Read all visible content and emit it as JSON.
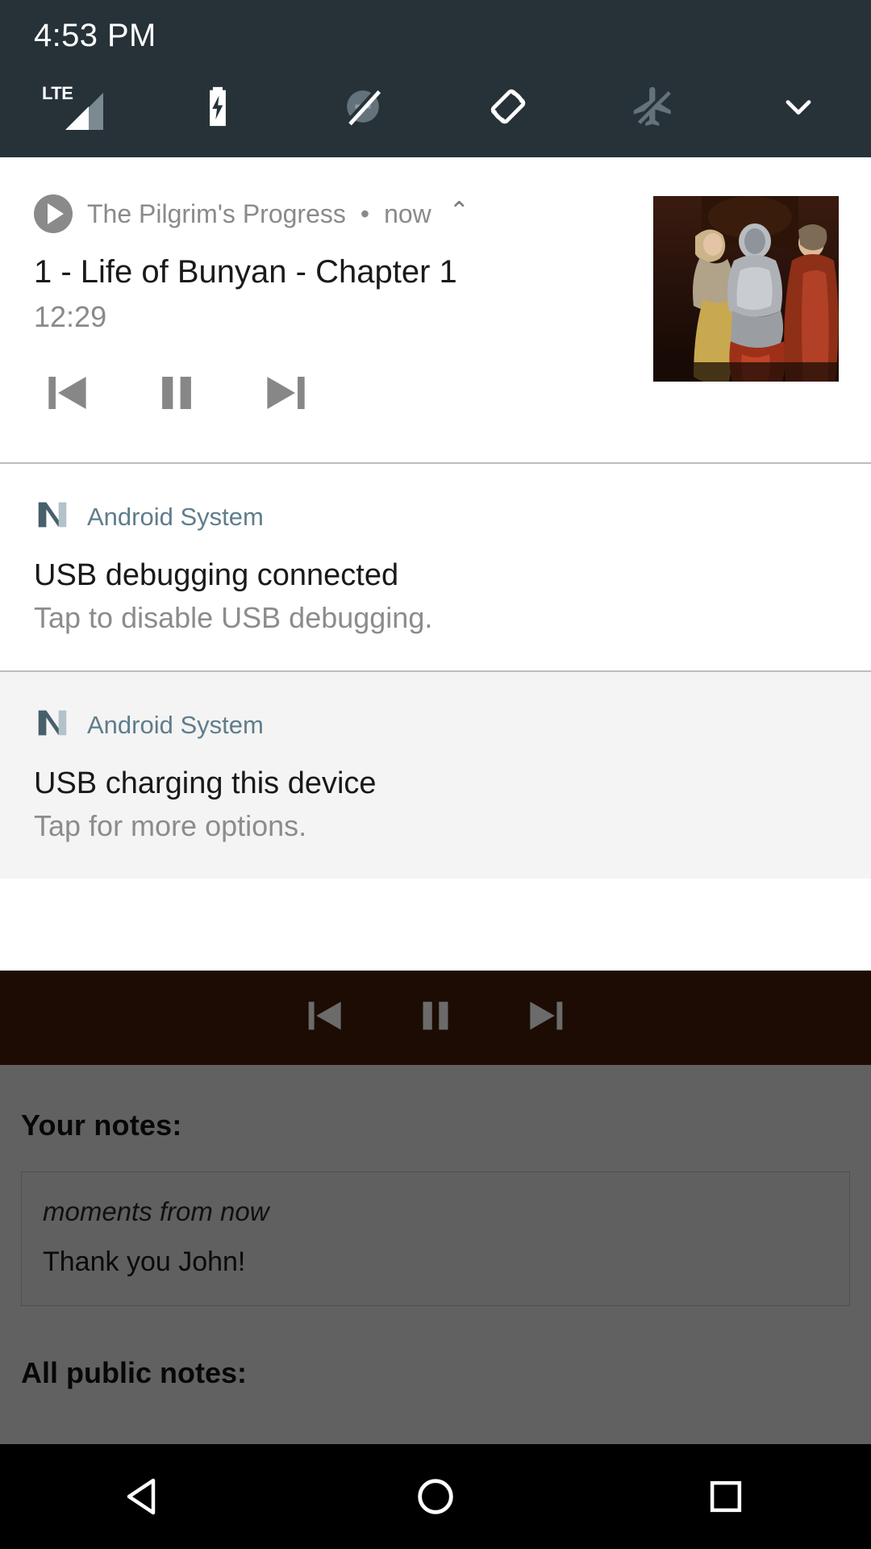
{
  "status_bar": {
    "clock": "4:53 PM",
    "icons": [
      {
        "name": "signal-lte-icon",
        "label": "LTE"
      },
      {
        "name": "battery-charging-icon",
        "label": "battery charging"
      },
      {
        "name": "do-not-disturb-off-icon",
        "label": "notifications silenced"
      },
      {
        "name": "auto-rotate-icon",
        "label": "screen rotation"
      },
      {
        "name": "airplane-mode-off-icon",
        "label": "airplane mode off"
      },
      {
        "name": "expand-chevron-icon",
        "label": "expand quick settings"
      }
    ]
  },
  "notifications": [
    {
      "type": "media",
      "app_name": "The Pilgrim's Progress",
      "separator": "•",
      "time": "now",
      "collapse_icon": "⌃",
      "title": "1 - Life of Bunyan - Chapter 1",
      "subtitle": "12:29",
      "controls": [
        {
          "name": "previous-button",
          "label": "previous"
        },
        {
          "name": "pause-button",
          "label": "pause"
        },
        {
          "name": "next-button",
          "label": "next"
        }
      ],
      "album_art": "oil painting of a kneeling knight in armour before courtiers"
    },
    {
      "type": "system",
      "app_name": "Android System",
      "icon": "android-nougat-icon",
      "title": "USB debugging connected",
      "body": "Tap to disable USB debugging.",
      "tinted": false
    },
    {
      "type": "system",
      "app_name": "Android System",
      "icon": "android-nougat-icon",
      "title": "USB charging this device",
      "body": "Tap for more options.",
      "tinted": true
    }
  ],
  "media_bar": {
    "controls": [
      {
        "name": "previous-button",
        "label": "previous"
      },
      {
        "name": "pause-button",
        "label": "pause"
      },
      {
        "name": "next-button",
        "label": "next"
      }
    ]
  },
  "app_content": {
    "your_notes_heading": "Your notes:",
    "note": {
      "timestamp": "moments from now",
      "text": "Thank you John!"
    },
    "public_notes_heading": "All public notes:"
  },
  "nav_bar": {
    "buttons": [
      {
        "name": "back-button",
        "label": "Back"
      },
      {
        "name": "home-button",
        "label": "Home"
      },
      {
        "name": "recents-button",
        "label": "Recents"
      }
    ]
  },
  "colors": {
    "status_bar_bg": "#263238",
    "system_app_accent": "#5f7d8c",
    "media_bar_bg": "#1d0c03",
    "notification_bg": "#ffffff",
    "notification_tinted_bg": "#f4f4f4"
  }
}
